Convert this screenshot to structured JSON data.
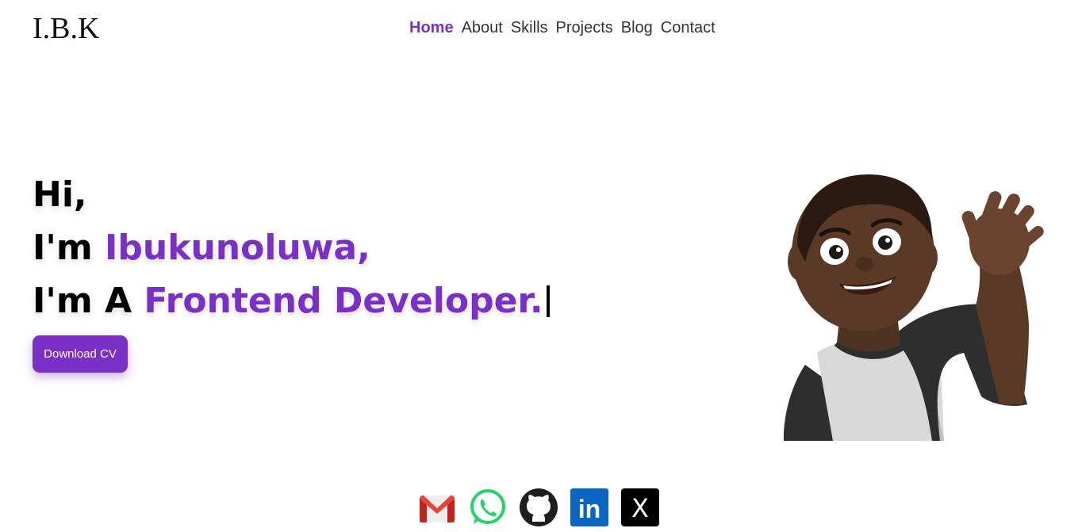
{
  "brand": {
    "logo": "I.B.K",
    "accent_color": "#7b2fc9"
  },
  "nav": {
    "items": [
      {
        "label": "Home",
        "active": true
      },
      {
        "label": "About"
      },
      {
        "label": "Skills"
      },
      {
        "label": "Projects"
      },
      {
        "label": "Blog"
      },
      {
        "label": "Contact"
      }
    ]
  },
  "hero": {
    "line1": "Hi,",
    "line2_prefix": "I'm ",
    "name": "Ibukunoluwa,",
    "line3_prefix": "I'm A ",
    "role": "Frontend Developer.",
    "cta_label": "Download CV"
  },
  "avatar": {
    "icon": "waving-avatar-illustration"
  },
  "socials": [
    {
      "icon": "gmail-icon"
    },
    {
      "icon": "whatsapp-icon"
    },
    {
      "icon": "github-icon"
    },
    {
      "icon": "linkedin-icon",
      "text": "in"
    },
    {
      "icon": "x-icon",
      "text": "X"
    }
  ]
}
